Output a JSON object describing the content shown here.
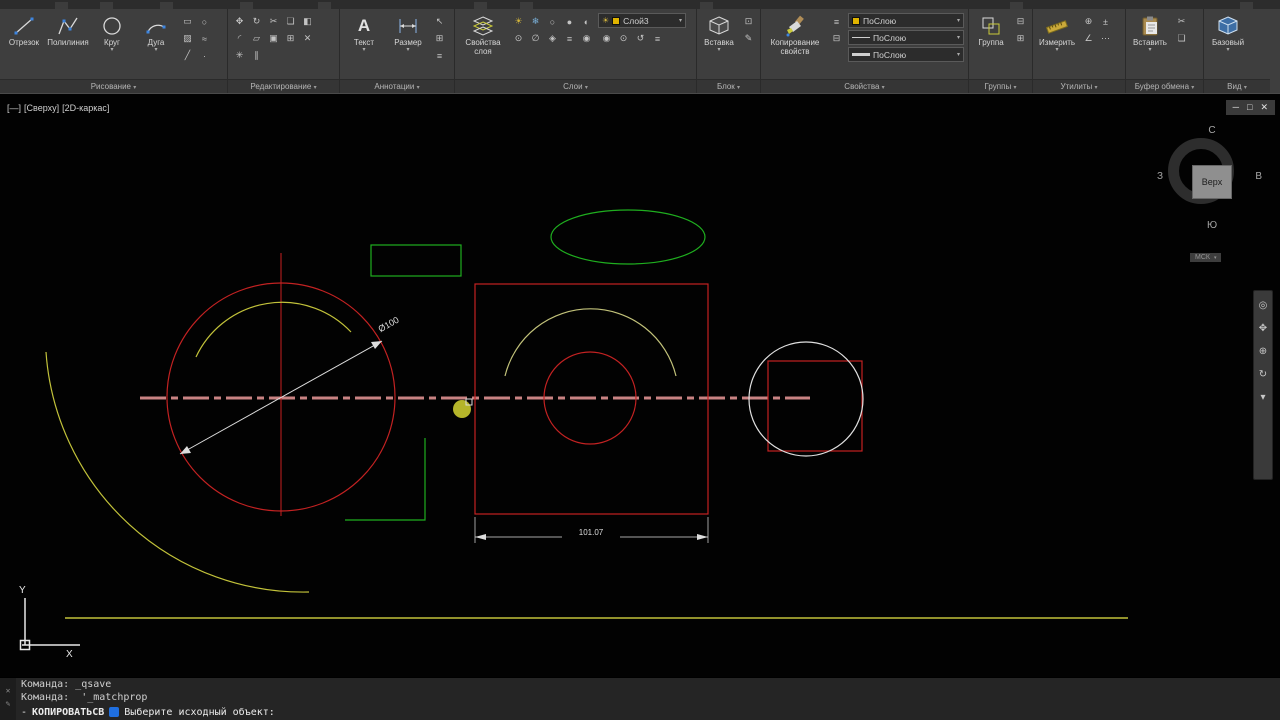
{
  "ribbon": {
    "caret": "▾",
    "panels": {
      "draw": "Рисование",
      "modify": "Редактирование",
      "annotation": "Аннотации",
      "layers": "Слои",
      "block": "Блок",
      "properties": "Свойства",
      "groups": "Группы",
      "utilities": "Утилиты",
      "clipboard": "Буфер обмена",
      "view": "Вид"
    },
    "buttons": {
      "line": "Отрезок",
      "polyline": "Полилиния",
      "circle": "Круг",
      "arc": "Дуга",
      "text": "Текст",
      "dimension": "Размер",
      "layer_properties": "Свойства слоя",
      "insert": "Вставка",
      "match_properties": "Копирование свойств",
      "group": "Группа",
      "measure": "Измерить",
      "paste": "Вставить",
      "base": "Базовый"
    },
    "layer_dropdown": {
      "current": "Слой3"
    },
    "property_dropdowns": {
      "color": "ПоСлою",
      "linetype": "ПоСлою",
      "lineweight": "ПоСлою"
    }
  },
  "icons": {
    "text_tool": "A",
    "layer_on": "☀",
    "rectangle": "▭",
    "ellipse": "○",
    "hatch": "▨",
    "revcloud": "≈",
    "ray": "╱",
    "point": "·",
    "move": "✥",
    "rotate": "↻",
    "trim": "✂",
    "copy": "❏",
    "mirror": "◧",
    "fillet": "◜",
    "stretch": "▱",
    "scale": "▣",
    "array": "⊞",
    "erase": "✕",
    "explode": "✳",
    "offset": "∥",
    "leader": "↖",
    "table": "⊞",
    "mtext": "≡",
    "l1": "☀",
    "l2": "❄",
    "l3": "○",
    "l4": "●",
    "l5": "◐",
    "l6": "⊙",
    "l7": "∅",
    "l8": "◈",
    "l9": "≡",
    "l10": "◉",
    "lr1": "◉",
    "lr2": "⊙",
    "lr3": "↺",
    "lr4": "≡",
    "make_block": "⊡",
    "edit_block": "✎",
    "prop_list": "≡",
    "prop_palette": "⊟",
    "ungroup": "⊟",
    "group_edit": "⊞",
    "u1": "⊕",
    "u2": "±",
    "u3": "∠",
    "u4": "⋯",
    "cut": "✂",
    "copy_clip": "❏",
    "nav_wheel": "◎",
    "nav_pan": "✥",
    "nav_zoom": "⊕",
    "nav_orbit": "↻",
    "nav_more": "▾",
    "cmd_close": "✕",
    "cmd_edit": "✎"
  },
  "viewport": {
    "controls": {
      "menu": "[—]",
      "view": "[Сверху]",
      "visual_style": "[2D-каркас]"
    },
    "window_buttons": {
      "minimize": "─",
      "restore": "□",
      "close": "✕"
    }
  },
  "viewcube": {
    "north": "С",
    "south": "Ю",
    "west": "З",
    "east": "В",
    "face": "Верх",
    "wcs": "МСК"
  },
  "drawing": {
    "diameter_dim": "Ø100",
    "linear_dim": "101.07",
    "ucs_x": "X",
    "ucs_y": "Y"
  },
  "command_line": {
    "history": [
      "Команда: _qsave",
      "Команда:  '_matchprop"
    ],
    "prompt_prefix": "-",
    "prompt_command": "КОПИРОВАТЬСВ",
    "prompt_text": "Выберите исходный объект:"
  }
}
